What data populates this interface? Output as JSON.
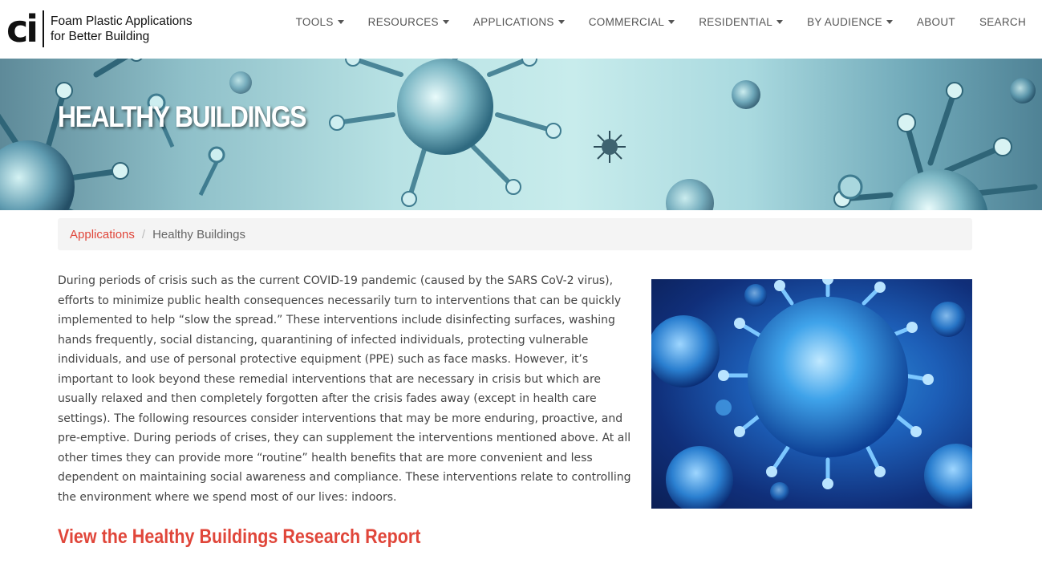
{
  "logo": {
    "mark": "ci",
    "line1": "Foam Plastic Applications",
    "line2": "for Better Building"
  },
  "nav": [
    {
      "label": "TOOLS",
      "dropdown": true
    },
    {
      "label": "RESOURCES",
      "dropdown": true
    },
    {
      "label": "APPLICATIONS",
      "dropdown": true
    },
    {
      "label": "COMMERCIAL",
      "dropdown": true
    },
    {
      "label": "RESIDENTIAL",
      "dropdown": true
    },
    {
      "label": "BY AUDIENCE",
      "dropdown": true
    },
    {
      "label": "ABOUT",
      "dropdown": false
    },
    {
      "label": "SEARCH",
      "dropdown": false
    }
  ],
  "hero": {
    "title": "HEALTHY BUILDINGS"
  },
  "breadcrumb": {
    "parent": "Applications",
    "separator": "/",
    "current": "Healthy Buildings"
  },
  "main": {
    "paragraph": "During periods of crisis such as the current COVID-19 pandemic (caused by the SARS CoV-2 virus), efforts to minimize public health consequences necessarily turn to interventions that can be quickly implemented to help “slow the spread.” These interventions include disinfecting surfaces, washing hands frequently, social distancing, quarantining of infected individuals, protecting vulnerable individuals, and use of personal protective equipment (PPE) such as face masks. However, it’s important to look beyond these remedial interventions that are necessary in crisis but which are usually relaxed and then completely forgotten after the crisis fades away (except in health care settings). The following resources consider interventions that may be more enduring, proactive, and pre-emptive. During periods of crises, they can supplement the interventions mentioned above. At all other times they can provide more “routine” health benefits that are more convenient and less dependent on maintaining social awareness and compliance. These interventions relate to controlling the environment where we spend most of our lives: indoors.",
    "report_link": "View the Healthy Buildings Research Report"
  },
  "colors": {
    "accent": "#e0463a",
    "nav_text": "#555555",
    "body_text": "#444444",
    "breadcrumb_bg": "#f4f4f4"
  }
}
